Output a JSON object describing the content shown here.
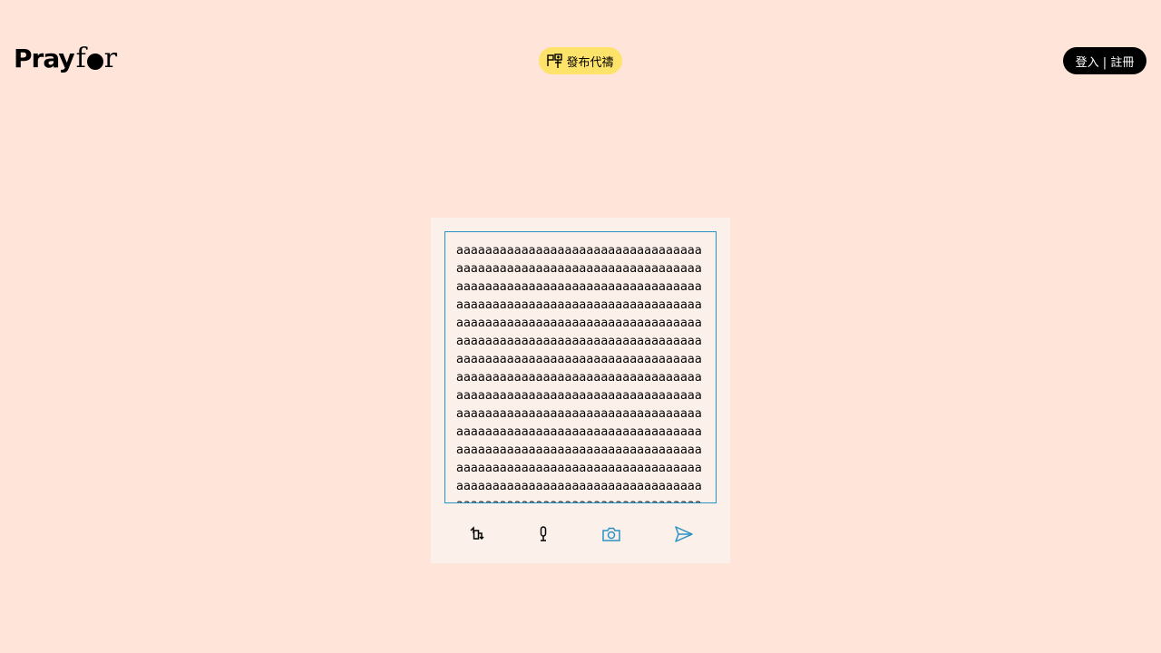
{
  "header": {
    "logo": {
      "text_left": "Pray",
      "text_f": "f",
      "text_r": "r"
    },
    "publish_button": {
      "icon": "prayer-post-icon",
      "label": "發布代禱"
    },
    "auth_button": {
      "label": "登入 | 註冊"
    }
  },
  "composer": {
    "text_value": "aaaaaaaaaaaaaaaaaaaaaaaaaaaaaaaaaaaaaaaaaaaaaaaaaaaaaaaaaaaaaaaaaaaaaaaaaaaaaaaaaaaaaaaaaaaaaaaaaaaaaaaaaaaaaaaaaaaaaaaaaaaaaaaaaaaaaaaaaaaaaaaaaaaaaaaaaaaaaaaaaaaaaaaaaaaaaaaaaaaaaaaaaaaaaaaaaaaaaaaaaaaaaaaaaaaaaaaaaaaaaaaaaaaaaaaaaaaaaaaaaaaaaaaaaaaaaaaaaaaaaaaaaaaaaaaaaaaaaaaaaaaaaaaaaaaaaaaaaaaaaaaaaaaaaaaaaaaaaaaaaaaaaaaaaaaaaaaaaaaaaaaaaaaaaaaaaaaaaaaaaaaaaaaaaaaaaaaaaaaaaaaaaaaaaaaaaaaaaaaaaaaaaaaaaaaaaaaaaaaaaaaaaaaaaaaaaaaaaaaaaaaaaaaaaaaaaaaaaaaaaaaaaaaaaaaaaaaaaaaaaaaaaaaaaaaaaaaaaaaaaaaaaaaaaaaaaaaaaaaaaaaaaaaaaaaaaaaaaaaaaaaaaaaaa",
    "toolbar": {
      "icons": [
        "rotate-icon",
        "microphone-icon",
        "camera-icon",
        "send-icon"
      ]
    }
  },
  "colors": {
    "page_background": "#ffe4da",
    "composer_background": "#fcf0ea",
    "accent_blue": "#2a93c5",
    "publish_yellow": "#fde36a",
    "auth_black": "#000000"
  }
}
